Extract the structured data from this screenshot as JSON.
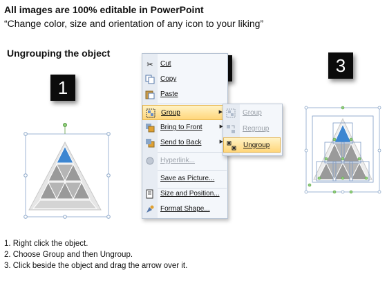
{
  "header": {
    "title": "All images are 100% editable in PowerPoint",
    "subtitle": "“Change color, size and orientation of any icon to your liking”"
  },
  "section_title": "Ungrouping the object",
  "step_badges": [
    "1",
    "2",
    "3"
  ],
  "context_menu": {
    "items": [
      {
        "label": "Cut",
        "icon": "scissors-icon"
      },
      {
        "label": "Copy",
        "icon": "copy-icon"
      },
      {
        "label": "Paste",
        "icon": "paste-icon"
      },
      {
        "label": "Group",
        "icon": "group-icon",
        "submenu": true,
        "highlighted": true
      },
      {
        "label": "Bring to Front",
        "icon": "bring-to-front-icon",
        "submenu": true
      },
      {
        "label": "Send to Back",
        "icon": "send-to-back-icon",
        "submenu": true
      },
      {
        "label": "Hyperlink...",
        "icon": "hyperlink-icon",
        "disabled": true
      },
      {
        "label": "Save as Picture...",
        "icon": ""
      },
      {
        "label": "Size and Position...",
        "icon": "size-position-icon"
      },
      {
        "label": "Format Shape...",
        "icon": "format-shape-icon"
      }
    ]
  },
  "submenu": {
    "items": [
      {
        "label": "Group",
        "disabled": true
      },
      {
        "label": "Regroup",
        "disabled": true
      },
      {
        "label": "Ungroup",
        "highlighted": true
      }
    ]
  },
  "instructions": [
    "1.  Right click the object.",
    "2.  Choose Group and then Ungroup.",
    "3.  Click beside the object and drag the arrow over it."
  ],
  "colors": {
    "accent_triangle": "#3d86d1",
    "gray_triangle": "#9a9a9a",
    "highlight": "#ffd67a"
  }
}
